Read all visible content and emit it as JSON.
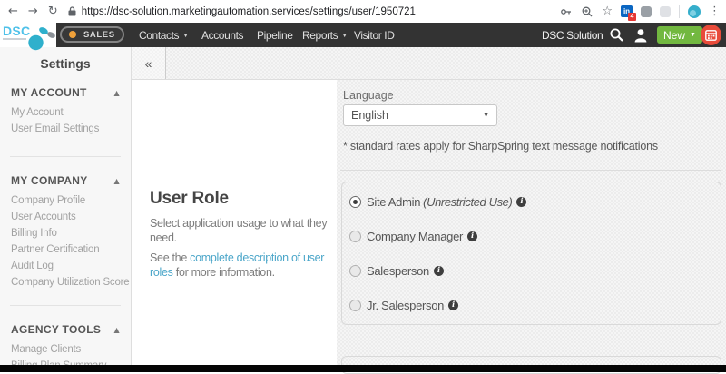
{
  "browser": {
    "url": "https://dsc-solution.marketingautomation.services/settings/user/1950721",
    "extension_badge": "4",
    "linkedin_label": "in"
  },
  "navbar": {
    "logo_text": "DSC",
    "env_label": "SALES",
    "items": [
      "Contacts",
      "Accounts",
      "Pipeline",
      "Reports",
      "Visitor ID"
    ],
    "account_name": "DSC Solution",
    "new_button_label": "New"
  },
  "sidebar": {
    "title": "Settings",
    "sections": [
      {
        "header": "MY ACCOUNT",
        "items": [
          "My Account",
          "User Email Settings"
        ]
      },
      {
        "header": "MY COMPANY",
        "items": [
          "Company Profile",
          "User Accounts",
          "Billing Info",
          "Partner Certification",
          "Audit Log",
          "Company Utilization Score"
        ]
      },
      {
        "header": "AGENCY TOOLS",
        "items": [
          "Manage Clients",
          "Billing Plan Summary"
        ]
      }
    ]
  },
  "main": {
    "collapse_label": "«",
    "language_label": "Language",
    "language_value": "English",
    "language_note": "* standard rates apply for SharpSpring text message notifications",
    "user_role": {
      "title": "User Role",
      "description": "Select application usage to what they need.",
      "link_prefix": "See the ",
      "link_text": "complete description of user roles",
      "link_suffix": " for more information.",
      "options": [
        {
          "label": "Site Admin",
          "suffix": "(Unrestricted Use)",
          "selected": true
        },
        {
          "label": "Company Manager",
          "suffix": "",
          "selected": false
        },
        {
          "label": "Salesperson",
          "suffix": "",
          "selected": false
        },
        {
          "label": "Jr. Salesperson",
          "suffix": "",
          "selected": false
        }
      ]
    }
  },
  "colors": {
    "brand_cyan": "#4fc1e9",
    "accent_green": "#72b840",
    "alert_red": "#e84b3a",
    "link_blue": "#4ba6c9"
  }
}
